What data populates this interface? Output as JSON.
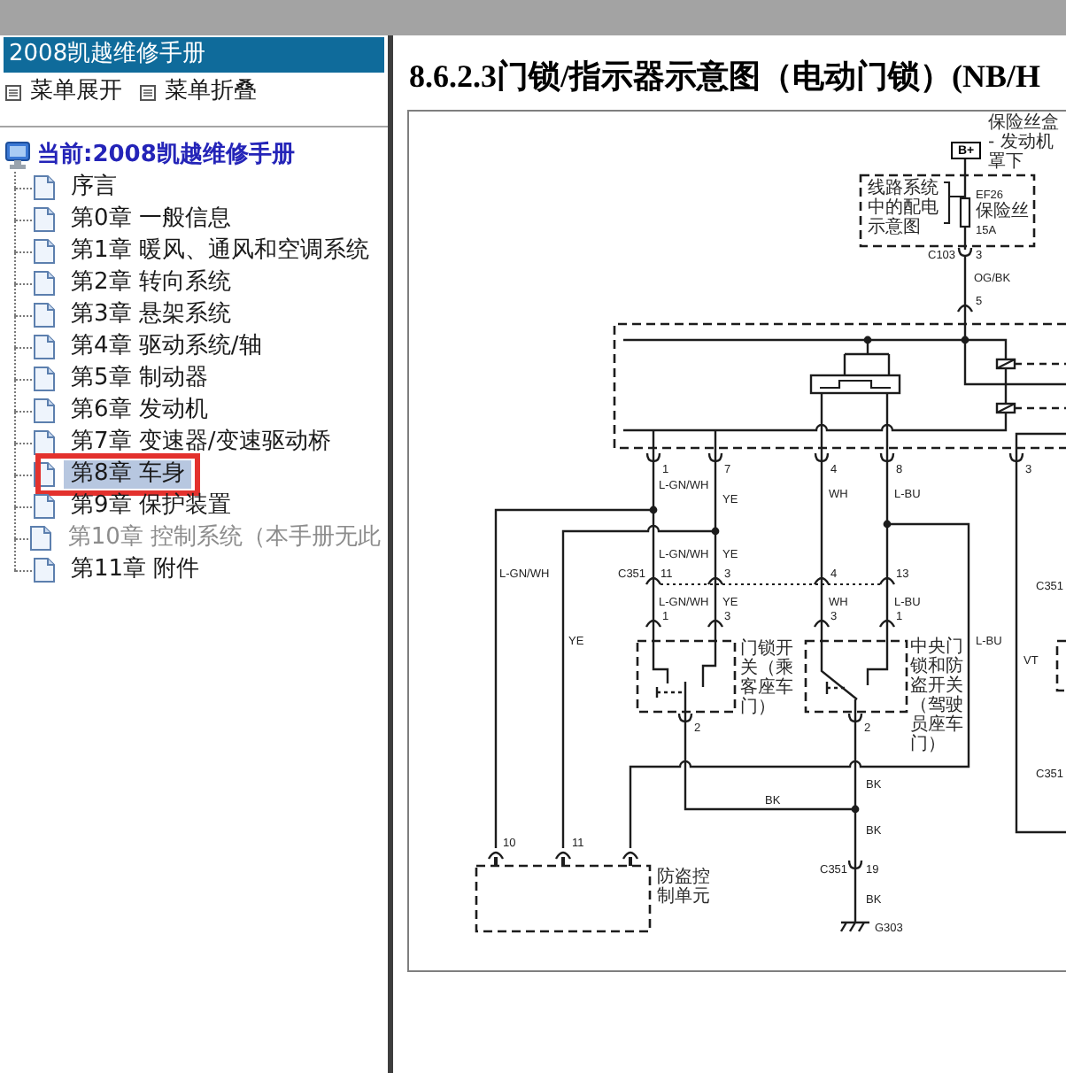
{
  "sidebar": {
    "title": "2008凯越维修手册",
    "menu_links": [
      "菜单展开",
      "菜单折叠"
    ],
    "tree": {
      "label": "当前:2008凯越维修手册",
      "children": [
        {
          "label": "序言",
          "selected": false,
          "disabled": false,
          "annotated": false
        },
        {
          "label": "第0章 一般信息",
          "selected": false,
          "disabled": false,
          "annotated": false
        },
        {
          "label": "第1章 暖风、通风和空调系统",
          "selected": false,
          "disabled": false,
          "annotated": false
        },
        {
          "label": "第2章 转向系统",
          "selected": false,
          "disabled": false,
          "annotated": false
        },
        {
          "label": "第3章 悬架系统",
          "selected": false,
          "disabled": false,
          "annotated": false
        },
        {
          "label": "第4章 驱动系统/轴",
          "selected": false,
          "disabled": false,
          "annotated": false
        },
        {
          "label": "第5章 制动器",
          "selected": false,
          "disabled": false,
          "annotated": false
        },
        {
          "label": "第6章 发动机",
          "selected": false,
          "disabled": false,
          "annotated": false
        },
        {
          "label": "第7章 变速器/变速驱动桥",
          "selected": false,
          "disabled": false,
          "annotated": false
        },
        {
          "label": "第8章 车身",
          "selected": true,
          "disabled": false,
          "annotated": true
        },
        {
          "label": "第9章 保护装置",
          "selected": false,
          "disabled": false,
          "annotated": false
        },
        {
          "label": "第10章 控制系统（本手册无此",
          "selected": false,
          "disabled": true,
          "annotated": false
        },
        {
          "label": "第11章 附件",
          "selected": false,
          "disabled": false,
          "annotated": false
        }
      ]
    }
  },
  "content": {
    "title": "8.6.2.3门锁/指示器示意图（电动门锁）(NB/H",
    "diagram": {
      "labels": [
        {
          "kind": "note",
          "text": "保险丝盒 - 发动机罩下"
        },
        {
          "kind": "terminal",
          "text": "B+"
        },
        {
          "kind": "note",
          "text": "线路系统中的配电示意图"
        },
        {
          "kind": "code",
          "text": "EF26"
        },
        {
          "kind": "note",
          "text": "保险丝"
        },
        {
          "kind": "code",
          "text": "15A"
        },
        {
          "kind": "code",
          "text": "C103"
        },
        {
          "kind": "code",
          "text": "3"
        },
        {
          "kind": "code",
          "text": "OG/BK"
        },
        {
          "kind": "code",
          "text": "5"
        },
        {
          "kind": "code",
          "text": "1"
        },
        {
          "kind": "code",
          "text": "7"
        },
        {
          "kind": "code",
          "text": "4"
        },
        {
          "kind": "code",
          "text": "8"
        },
        {
          "kind": "code",
          "text": "3"
        },
        {
          "kind": "code",
          "text": "L-GN/WH"
        },
        {
          "kind": "code",
          "text": "WH"
        },
        {
          "kind": "code",
          "text": "L-BU"
        },
        {
          "kind": "code",
          "text": "YE"
        },
        {
          "kind": "code",
          "text": "L-GN/WH"
        },
        {
          "kind": "code",
          "text": "YE"
        },
        {
          "kind": "code",
          "text": "L-GN/WH"
        },
        {
          "kind": "code",
          "text": "C351"
        },
        {
          "kind": "code",
          "text": "11"
        },
        {
          "kind": "code",
          "text": "3"
        },
        {
          "kind": "code",
          "text": "4"
        },
        {
          "kind": "code",
          "text": "13"
        },
        {
          "kind": "code",
          "text": "C351"
        },
        {
          "kind": "code",
          "text": "L-GN/WH"
        },
        {
          "kind": "code",
          "text": "YE"
        },
        {
          "kind": "code",
          "text": "WH"
        },
        {
          "kind": "code",
          "text": "L-BU"
        },
        {
          "kind": "code",
          "text": "1"
        },
        {
          "kind": "code",
          "text": "3"
        },
        {
          "kind": "code",
          "text": "3"
        },
        {
          "kind": "code",
          "text": "1"
        },
        {
          "kind": "code",
          "text": "YE"
        },
        {
          "kind": "note",
          "text": "门锁开关（乘客座车门）"
        },
        {
          "kind": "note",
          "text": "中央门锁和防盗开关（驾驶员座车门）"
        },
        {
          "kind": "code",
          "text": "L-BU"
        },
        {
          "kind": "code",
          "text": "VT"
        },
        {
          "kind": "code",
          "text": "2"
        },
        {
          "kind": "code",
          "text": "2"
        },
        {
          "kind": "code",
          "text": "C351"
        },
        {
          "kind": "code",
          "text": "BK"
        },
        {
          "kind": "code",
          "text": "BK"
        },
        {
          "kind": "code",
          "text": "BK"
        },
        {
          "kind": "code",
          "text": "10"
        },
        {
          "kind": "code",
          "text": "11"
        },
        {
          "kind": "note",
          "text": "防盗控制单元"
        },
        {
          "kind": "code",
          "text": "C351"
        },
        {
          "kind": "code",
          "text": "19"
        },
        {
          "kind": "code",
          "text": "BK"
        },
        {
          "kind": "code",
          "text": "G303"
        }
      ]
    }
  }
}
